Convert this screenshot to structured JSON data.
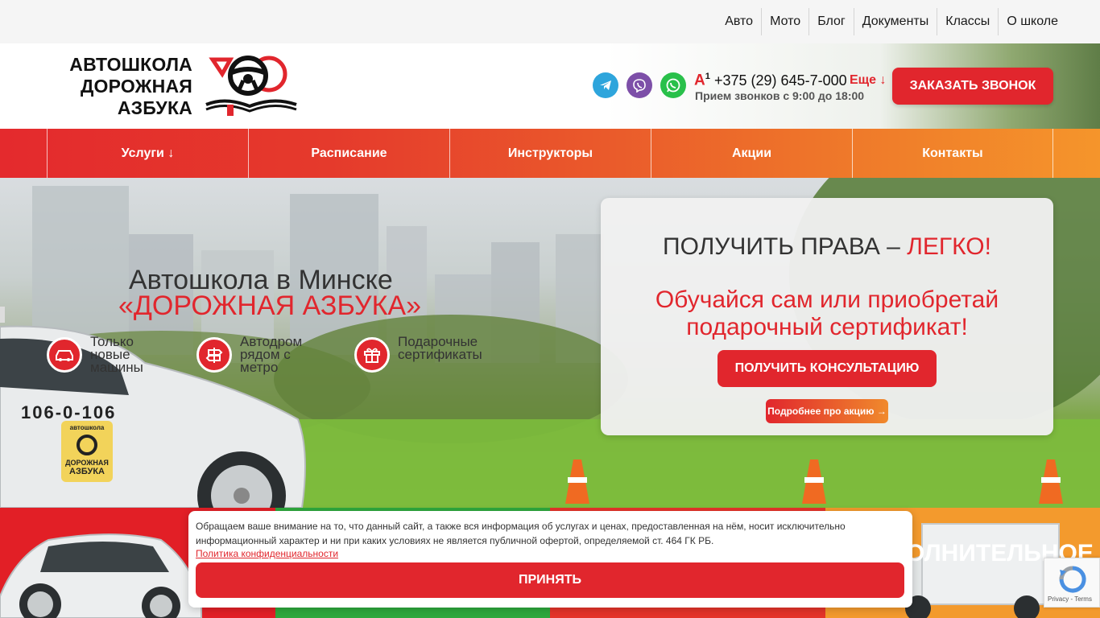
{
  "topnav": {
    "items": [
      "Авто",
      "Мото",
      "Блог",
      "Документы",
      "Классы",
      "О школе"
    ]
  },
  "header": {
    "logo_line1": "АВТОШКОЛА",
    "logo_line2": "ДОРОЖНАЯ",
    "logo_line3": "АЗБУКА",
    "operator": "A",
    "operator_sup": "1",
    "phone": "+375 (29) 645-7-000",
    "more": "Еще ↓",
    "hours": "Прием звонков с 9:00 до 18:00",
    "callback_label": "ЗАКАЗАТЬ ЗВОНОК"
  },
  "mainnav": {
    "items": [
      "Услуги ↓",
      "Расписание",
      "Инструкторы",
      "Акции",
      "Контакты"
    ]
  },
  "hero": {
    "title1": "Автошкола в Минске",
    "title2": "«ДОРОЖНАЯ АЗБУКА»",
    "features": [
      {
        "icon": "car-icon",
        "text": "Только новые машины"
      },
      {
        "icon": "signpost-icon",
        "text": "Автодром рядом с метро"
      },
      {
        "icon": "gift-icon",
        "text": "Подарочные сертификаты"
      }
    ],
    "car_plate": "106-0-106",
    "car_badge_top": "автошкола",
    "car_badge_line1": "ДОРОЖНАЯ",
    "car_badge_line2": "АЗБУКА"
  },
  "promo": {
    "heading_part1": "ПОЛУЧИТЬ ПРАВА – ",
    "heading_part2": "ЛЕГКО!",
    "sub": "Обучайся сам или приобретай подарочный сертификат!",
    "consult_label": "ПОЛУЧИТЬ КОНСУЛЬТАЦИЮ",
    "more_label": "Подробнее про акцию →"
  },
  "bottom": {
    "orange_word": "ОЛНИТЕЛЬНОЕ"
  },
  "cookie": {
    "text": "Обращаем ваше внимание на то, что данный сайт, а также вся информация об услугах и ценах, предоставленная на нём, носит исключительно информационный характер и ни при каких условиях не является публичной офертой, определяемой ст. 464 ГК РБ.",
    "link": "Политика конфиденциальности",
    "accept_label": "ПРИНЯТЬ"
  },
  "recaptcha": {
    "text": "Privacy - Terms"
  },
  "colors": {
    "brand_red": "#e1262d",
    "nav_gradient_end": "#f5952b"
  }
}
